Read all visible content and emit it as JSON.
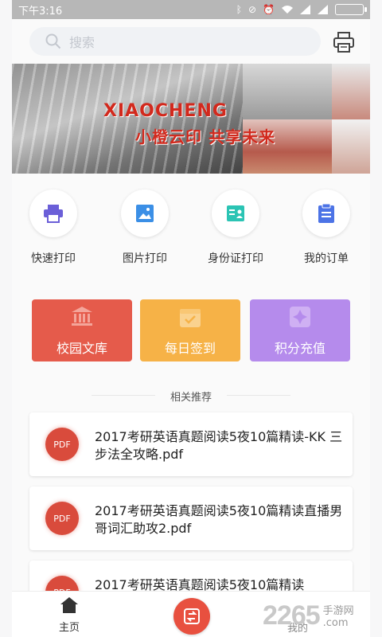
{
  "status_bar": {
    "time": "下午3:16",
    "icons": [
      "bluetooth-icon",
      "mute-icon",
      "alarm-icon",
      "wifi-icon",
      "signal-icon",
      "signal-icon",
      "battery-icon"
    ]
  },
  "search": {
    "placeholder": "搜索"
  },
  "banner": {
    "title_en": "XIAOCHENG",
    "title_cn": "小橙云印 共享未来"
  },
  "quick_actions": [
    {
      "label": "快速打印",
      "icon": "printer-icon",
      "color": "#6b5fd8"
    },
    {
      "label": "图片打印",
      "icon": "image-icon",
      "color": "#3b8fe6"
    },
    {
      "label": "身份证打印",
      "icon": "id-card-icon",
      "color": "#2bc4b4"
    },
    {
      "label": "我的订单",
      "icon": "clipboard-icon",
      "color": "#4c73e6"
    }
  ],
  "feature_cards": [
    {
      "label": "校园文库",
      "icon": "library-icon",
      "color": "#e55b4b"
    },
    {
      "label": "每日签到",
      "icon": "check-in-icon",
      "color": "#f6b247"
    },
    {
      "label": "积分充值",
      "icon": "points-icon",
      "color": "#b58bec"
    }
  ],
  "section_title": "相关推荐",
  "documents": [
    {
      "badge": "PDF",
      "title": "2017考研英语真题阅读5夜10篇精读-KK 三步法全攻略.pdf"
    },
    {
      "badge": "PDF",
      "title": "2017考研英语真题阅读5夜10篇精读直播男哥词汇助攻2.pdf"
    },
    {
      "badge": "PDF",
      "title": "2017考研英语真题阅读5夜10篇精读"
    }
  ],
  "bottom_nav": {
    "home": "主页",
    "mine": "我的"
  },
  "watermark": {
    "number": "2265",
    "site": "手游网",
    "domain": ".com"
  }
}
